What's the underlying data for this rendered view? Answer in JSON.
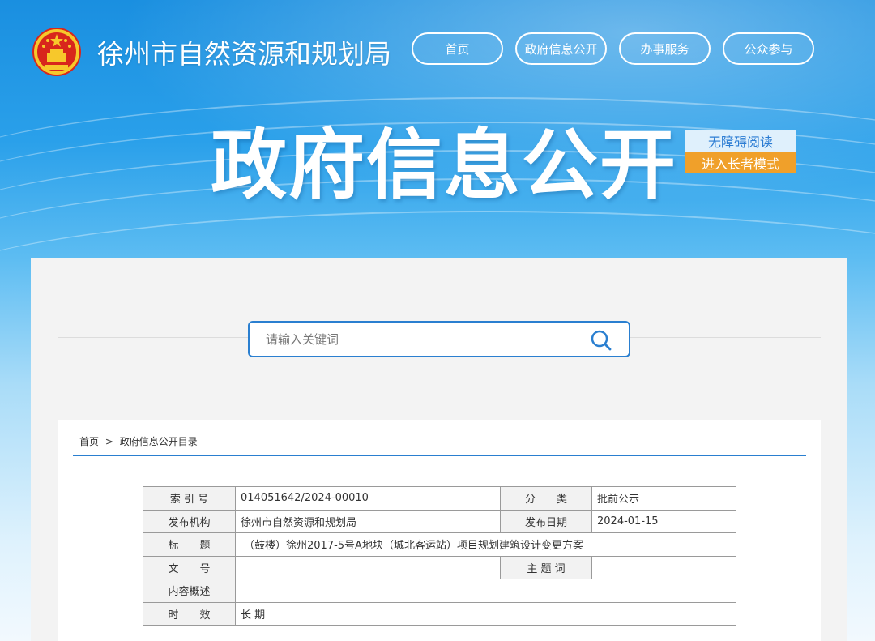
{
  "header": {
    "site_title": "徐州市自然资源和规划局",
    "nav": [
      "首页",
      "政府信息公开",
      "办事服务",
      "公众参与"
    ]
  },
  "hero": {
    "title": "政府信息公开",
    "accessibility_label": "无障碍阅读",
    "elder_mode_label": "进入长者模式"
  },
  "search": {
    "placeholder": "请输入关键词"
  },
  "breadcrumb": {
    "home": "首页",
    "separator": ">",
    "current": "政府信息公开目录"
  },
  "info_table": {
    "index_label": "索 引 号",
    "index_value": "014051642/2024-00010",
    "category_label": "分　　类",
    "category_value": "批前公示",
    "publisher_label": "发布机构",
    "publisher_value": "徐州市自然资源和规划局",
    "date_label": "发布日期",
    "date_value": "2024-01-15",
    "title_label": "标　　题",
    "title_value": "（鼓楼）徐州2017-5号A地块（城北客运站）项目规划建筑设计变更方案",
    "doc_no_label": "文　　号",
    "doc_no_value": "",
    "keywords_label": "主 题 词",
    "keywords_value": "",
    "summary_label": "内容概述",
    "summary_value": "",
    "validity_label": "时　　效",
    "validity_value": "长 期"
  },
  "colors": {
    "accent": "#2a7fd0",
    "elder_button": "#f0a02a",
    "banner_top": "#1a8fe0"
  }
}
